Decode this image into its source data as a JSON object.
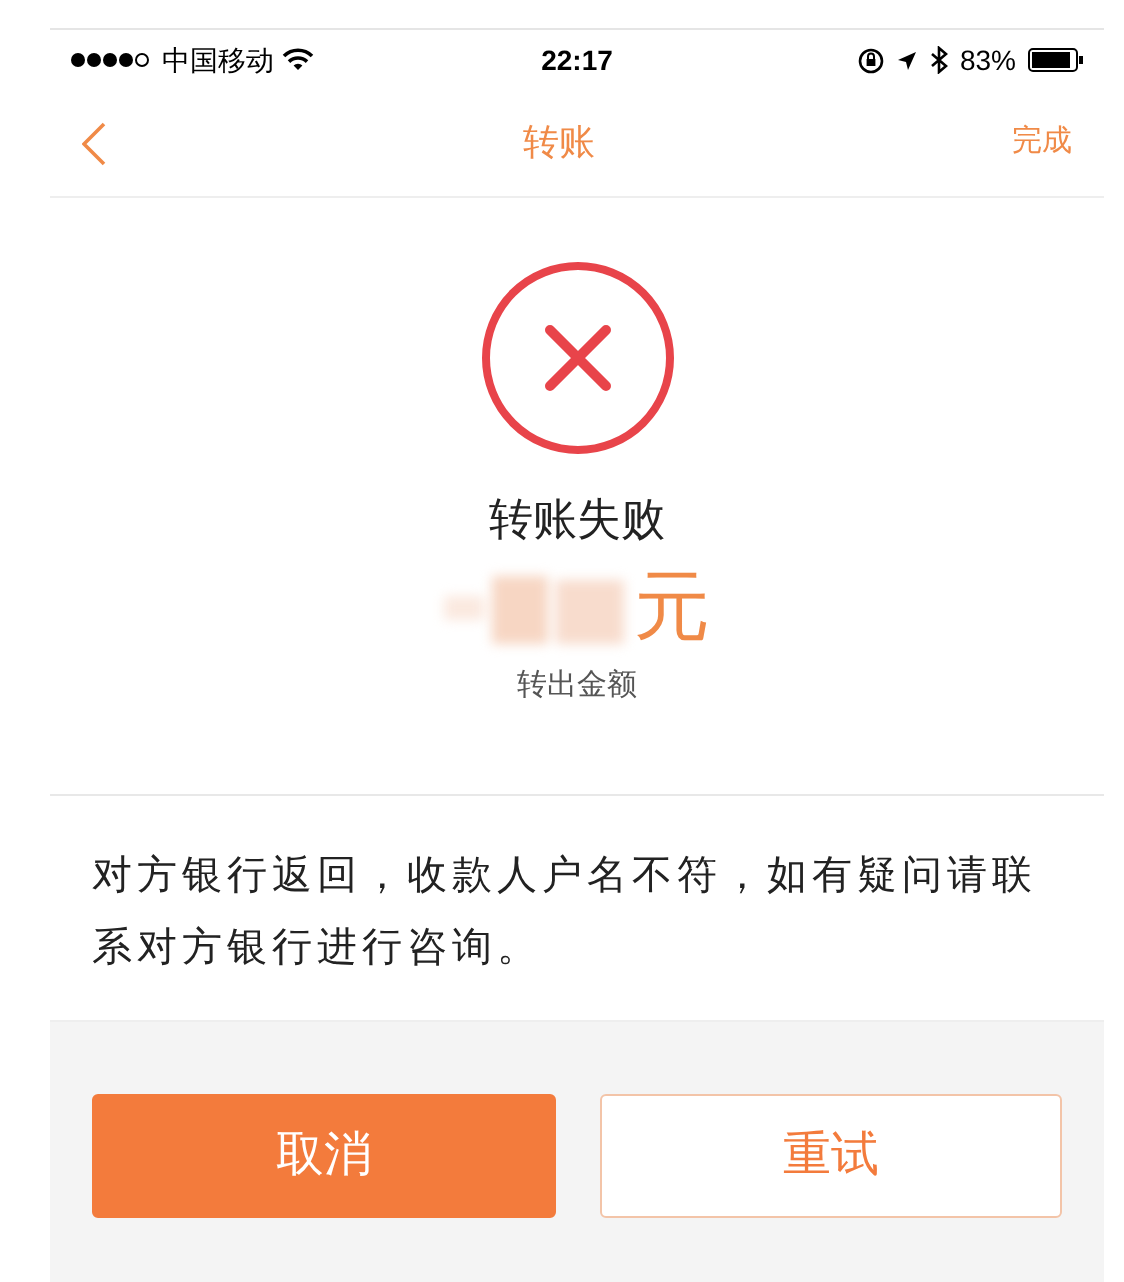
{
  "status_bar": {
    "carrier": "中国移动",
    "time": "22:17",
    "battery": "83%"
  },
  "nav_bar": {
    "title": "转账",
    "action": "完成"
  },
  "result": {
    "status": "转账失败",
    "amount_unit": "元",
    "amount_label": "转出金额"
  },
  "message": "对方银行返回，收款人户名不符，如有疑问请联系对方银行进行咨询。",
  "buttons": [
    {
      "label": "取消",
      "kind": "primary"
    },
    {
      "label": "重试",
      "kind": "secondary"
    }
  ]
}
